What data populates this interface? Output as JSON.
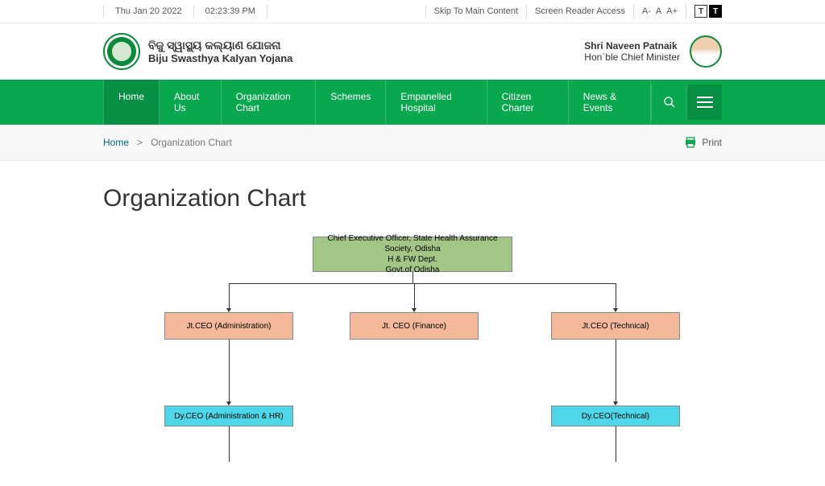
{
  "topbar": {
    "date": "Thu Jan 20 2022",
    "time": "02:23:39 PM",
    "skip": "Skip To Main Content",
    "reader": "Screen Reader Access",
    "a_minus": "A-",
    "a": "A",
    "a_plus": "A+",
    "t1": "T",
    "t2": "T"
  },
  "brand": {
    "odia": "ବିଜୁ ସ୍ୱାସ୍ଥ୍ୟ କଲ୍ୟାଣ ଯୋଜନା",
    "en": "Biju Swasthya Kalyan Yojana"
  },
  "minister": {
    "name": "Shri Naveen Patnaik",
    "title": "Hon`ble Chief Minister"
  },
  "nav": {
    "home": "Home",
    "about": "About Us",
    "org": "Organization Chart",
    "schemes": "Schemes",
    "hospital": "Empanelled Hospital",
    "charter": "Citizen Charter",
    "news": "News & Events"
  },
  "breadcrumb": {
    "home": "Home",
    "sep": ">",
    "current": "Organization Chart",
    "print": "Print"
  },
  "page": {
    "title": "Organization Chart"
  },
  "chart_data": {
    "type": "tree",
    "root": {
      "label": "Chief Executive Officer, State Health Assurance Society, Odisha\nH & FW Dept.\nGovt.of Odisha",
      "color": "#a3c585"
    },
    "level1": [
      {
        "label": "Jt.CEO (Administration)",
        "color": "#f4b89a"
      },
      {
        "label": "Jt. CEO (Finance)",
        "color": "#f4b89a"
      },
      {
        "label": "Jt.CEO (Technical)",
        "color": "#f4b89a"
      }
    ],
    "level2": [
      {
        "label": "Dy.CEO (Administration & HR)",
        "parent": 0,
        "color": "#4dd7e8"
      },
      {
        "label": "Dy.CEO(Technical)",
        "parent": 2,
        "color": "#4dd7e8"
      }
    ]
  }
}
